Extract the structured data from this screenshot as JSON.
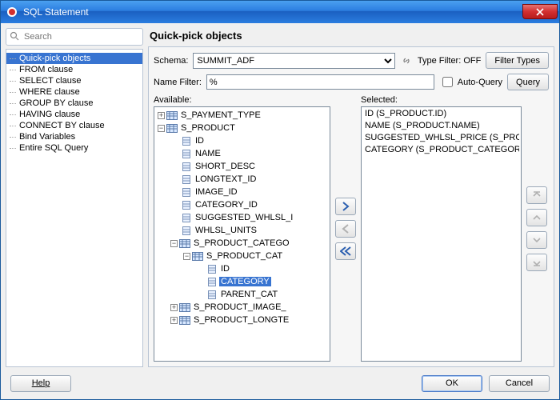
{
  "window": {
    "title": "SQL Statement"
  },
  "search": {
    "placeholder": "Search"
  },
  "nav": {
    "items": [
      "Quick-pick objects",
      "FROM clause",
      "SELECT clause",
      "WHERE clause",
      "GROUP BY clause",
      "HAVING clause",
      "CONNECT BY clause",
      "Bind Variables",
      "Entire SQL Query"
    ],
    "selected_index": 0
  },
  "section": {
    "title": "Quick-pick objects"
  },
  "schema": {
    "label": "Schema:",
    "value": "SUMMIT_ADF"
  },
  "type_filter": {
    "label": "Type Filter:",
    "value": "OFF",
    "button": "Filter Types"
  },
  "name_filter": {
    "label": "Name Filter:",
    "value": "%"
  },
  "auto_query": {
    "label": "Auto-Query",
    "checked": false
  },
  "query_button": "Query",
  "available": {
    "label": "Available:",
    "tree": [
      {
        "depth": 0,
        "exp": "+",
        "icon": "table",
        "label": "S_PAYMENT_TYPE"
      },
      {
        "depth": 0,
        "exp": "-",
        "icon": "table",
        "label": "S_PRODUCT"
      },
      {
        "depth": 1,
        "exp": "",
        "icon": "col",
        "label": "ID"
      },
      {
        "depth": 1,
        "exp": "",
        "icon": "col",
        "label": "NAME"
      },
      {
        "depth": 1,
        "exp": "",
        "icon": "col",
        "label": "SHORT_DESC"
      },
      {
        "depth": 1,
        "exp": "",
        "icon": "col",
        "label": "LONGTEXT_ID"
      },
      {
        "depth": 1,
        "exp": "",
        "icon": "col",
        "label": "IMAGE_ID"
      },
      {
        "depth": 1,
        "exp": "",
        "icon": "col",
        "label": "CATEGORY_ID"
      },
      {
        "depth": 1,
        "exp": "",
        "icon": "col",
        "label": "SUGGESTED_WHLSL_I"
      },
      {
        "depth": 1,
        "exp": "",
        "icon": "col",
        "label": "WHLSL_UNITS"
      },
      {
        "depth": 1,
        "exp": "-",
        "icon": "table",
        "label": "S_PRODUCT_CATEGO"
      },
      {
        "depth": 2,
        "exp": "-",
        "icon": "table",
        "label": "S_PRODUCT_CAT"
      },
      {
        "depth": 3,
        "exp": "",
        "icon": "col",
        "label": "ID"
      },
      {
        "depth": 3,
        "exp": "",
        "icon": "col",
        "label": "CATEGORY",
        "selected": true
      },
      {
        "depth": 3,
        "exp": "",
        "icon": "col",
        "label": "PARENT_CAT"
      },
      {
        "depth": 1,
        "exp": "+",
        "icon": "table",
        "label": "S_PRODUCT_IMAGE_"
      },
      {
        "depth": 1,
        "exp": "+",
        "icon": "table",
        "label": "S_PRODUCT_LONGTE"
      }
    ]
  },
  "selected": {
    "label": "Selected:",
    "items": [
      "ID (S_PRODUCT.ID)",
      "NAME (S_PRODUCT.NAME)",
      "SUGGESTED_WHLSL_PRICE (S_PROD",
      "CATEGORY (S_PRODUCT_CATEGORI"
    ]
  },
  "footer": {
    "help": "Help",
    "ok": "OK",
    "cancel": "Cancel"
  }
}
